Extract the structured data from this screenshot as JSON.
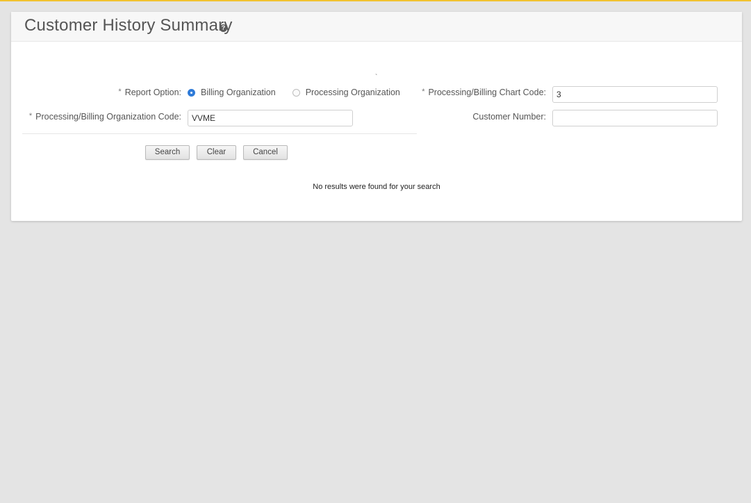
{
  "colors": {
    "accent": "#f2c230",
    "radio_selected": "#2f7bd8",
    "background": "#e4e4e4"
  },
  "header": {
    "title": "Customer History Summary",
    "help_icon": "question-circle-icon",
    "help_glyph": "?"
  },
  "form": {
    "required_marker": "*",
    "stray_mark": "`",
    "report_option": {
      "label": "Report Option:",
      "options": [
        {
          "label": "Billing Organization",
          "selected": true
        },
        {
          "label": "Processing Organization",
          "selected": false
        }
      ]
    },
    "org_code": {
      "label": "Processing/Billing Organization Code:",
      "value": "VVME"
    },
    "chart_code": {
      "label": "Processing/Billing Chart Code:",
      "value": "3"
    },
    "customer_number": {
      "label": "Customer Number:",
      "value": ""
    }
  },
  "buttons": {
    "search": "Search",
    "clear": "Clear",
    "cancel": "Cancel"
  },
  "results": {
    "message": "No results were found for your search"
  }
}
